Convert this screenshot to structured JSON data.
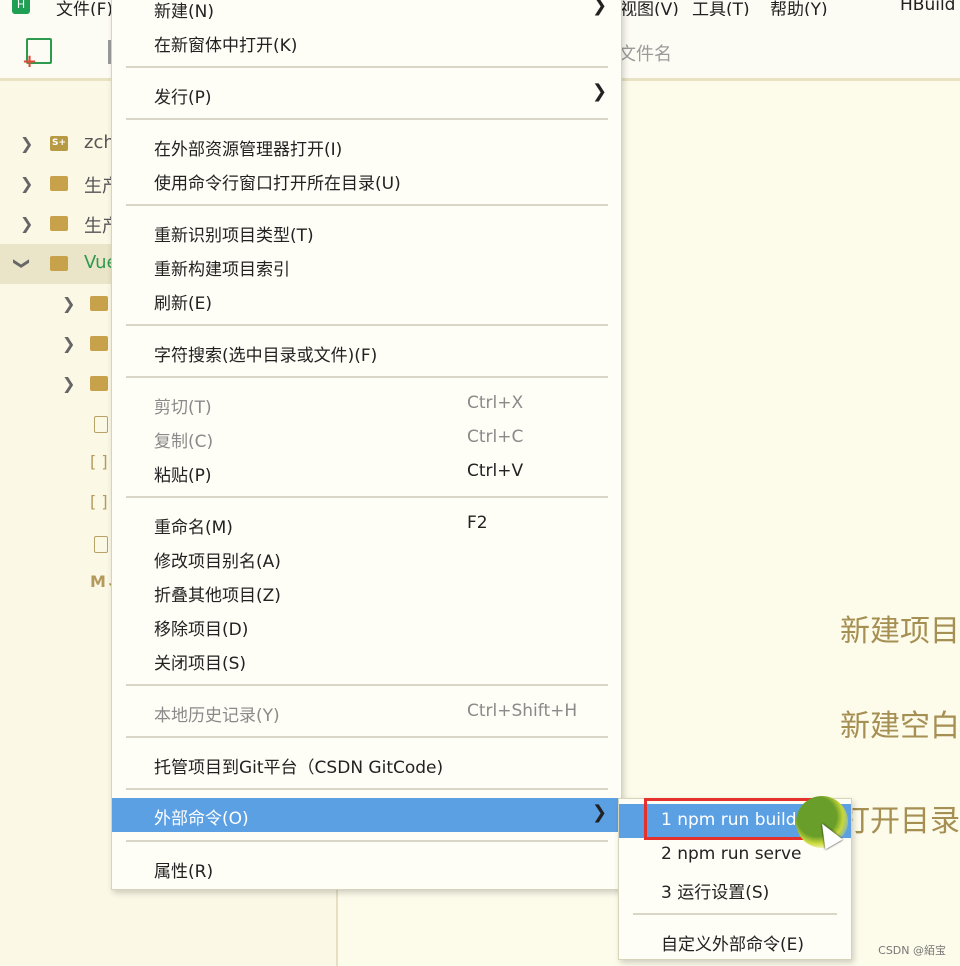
{
  "menubar": {
    "logo": "H",
    "items": [
      "文件(F)",
      "视图(V)",
      "工具(T)",
      "帮助(Y)",
      "HBuild"
    ]
  },
  "toolbar": {
    "search_hint": "文件名"
  },
  "sidebar": {
    "rows": [
      {
        "label": "zch",
        "icon": "project-icon"
      },
      {
        "label": "生产",
        "icon": "folder-icon"
      },
      {
        "label": "生产",
        "icon": "folder-icon"
      },
      {
        "label": "Vue",
        "icon": "folder-icon"
      },
      {
        "label": "",
        "icon": "folder-icon"
      },
      {
        "label": "",
        "icon": "folder-icon"
      },
      {
        "label": "",
        "icon": "folder-icon"
      },
      {
        "label": "",
        "icon": "file-icon"
      },
      {
        "label": "[ ]",
        "icon": "json-icon"
      },
      {
        "label": "[ ]",
        "icon": "json-icon"
      },
      {
        "label": "",
        "icon": "file-icon"
      },
      {
        "label": "M↓",
        "icon": "markdown-icon"
      }
    ]
  },
  "context_menu": {
    "new": "新建(N)",
    "open_new_window": "在新窗体中打开(K)",
    "publish": "发行(P)",
    "open_explorer": "在外部资源管理器打开(I)",
    "open_cmd": "使用命令行窗口打开所在目录(U)",
    "reidentify": "重新识别项目类型(T)",
    "rebuild_index": "重新构建项目索引",
    "refresh": "刷新(E)",
    "search": "字符搜索(选中目录或文件)(F)",
    "cut": "剪切(T)",
    "cut_sc": "Ctrl+X",
    "copy": "复制(C)",
    "copy_sc": "Ctrl+C",
    "paste": "粘贴(P)",
    "paste_sc": "Ctrl+V",
    "rename": "重命名(M)",
    "rename_sc": "F2",
    "alias": "修改项目别名(A)",
    "collapse": "折叠其他项目(Z)",
    "remove": "移除项目(D)",
    "close": "关闭项目(S)",
    "history": "本地历史记录(Y)",
    "history_sc": "Ctrl+Shift+H",
    "git": "托管项目到Git平台（CSDN GitCode)",
    "external": "外部命令(O)",
    "properties": "属性(R)"
  },
  "submenu": {
    "build": "1 npm run build",
    "serve": "2 npm run serve",
    "settings": "3 运行设置(S)",
    "custom": "自定义外部命令(E)"
  },
  "welcome": {
    "new_project": "新建项目",
    "new_blank": "新建空白",
    "open_dir": "打开目录"
  },
  "footer": "CSDN @絔宝"
}
